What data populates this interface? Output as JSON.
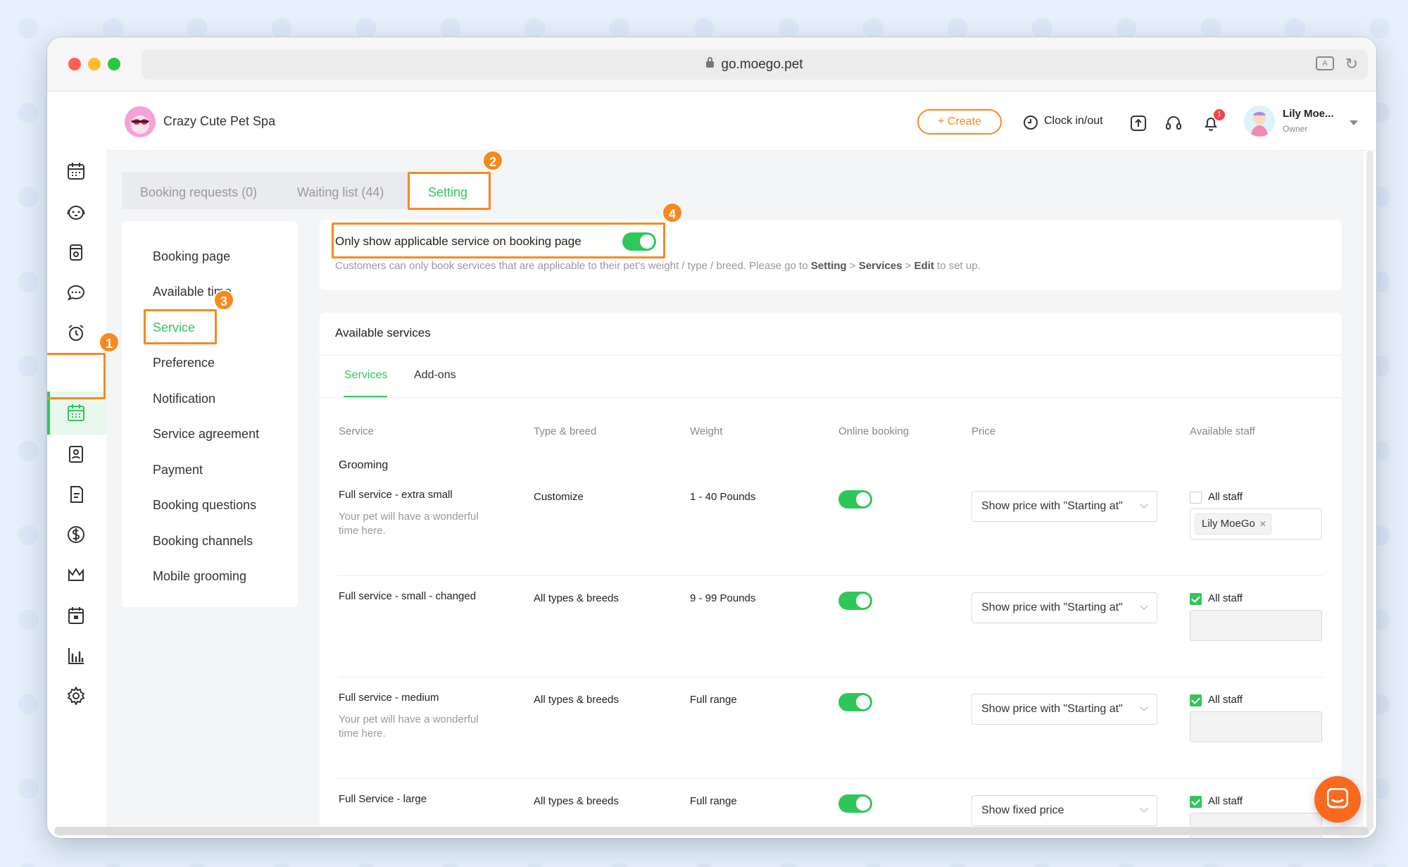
{
  "browser": {
    "url": "go.moego.pet"
  },
  "business": {
    "name": "Crazy Cute Pet Spa"
  },
  "topbar": {
    "create_label": "+ Create",
    "clock_label": "Clock in/out",
    "notif_count": "1",
    "user_name": "Lily Moe...",
    "user_role": "Owner"
  },
  "tabs": {
    "booking_requests": "Booking requests (0)",
    "waiting_list": "Waiting list (44)",
    "setting": "Setting"
  },
  "menu": [
    "Booking page",
    "Available time",
    "Service",
    "Preference",
    "Notification",
    "Service agreement",
    "Payment",
    "Booking questions",
    "Booking channels",
    "Mobile grooming"
  ],
  "applicable": {
    "label": "Only show applicable service on booking page",
    "desc_pre": "Customers can only book services that are applicable to their pet's weight / type / breed. Please go to ",
    "desc_b1": "Setting",
    "desc_sep1": " > ",
    "desc_b2": "Services",
    "desc_sep2": " > ",
    "desc_b3": "Edit",
    "desc_post": " to set up.",
    "enabled": true
  },
  "available": {
    "title": "Available services",
    "subtabs": [
      "Services",
      "Add-ons"
    ],
    "columns": [
      "Service",
      "Type & breed",
      "Weight",
      "Online booking",
      "Price",
      "Available staff"
    ],
    "group": "Grooming",
    "rows": [
      {
        "name": "Full service - extra small",
        "desc": "Your pet will have a wonderful time here.",
        "desc1": "Your pet will have a wonderful",
        "desc2": "time here.",
        "type": "Customize",
        "weight": "1 - 40 Pounds",
        "online": true,
        "price": "Show price with \"Starting at\"",
        "all_staff": false,
        "staff_label": "All staff",
        "staff_tag": "Lily MoeGo"
      },
      {
        "name": "Full service - small - changed",
        "desc1": "",
        "desc2": "",
        "type": "All types & breeds",
        "weight": "9 - 99 Pounds",
        "online": true,
        "price": "Show price with \"Starting at\"",
        "all_staff": true,
        "staff_label": "All staff",
        "staff_tag": ""
      },
      {
        "name": "Full service - medium",
        "desc1": "Your pet will have a wonderful",
        "desc2": "time here.",
        "type": "All types & breeds",
        "weight": "Full range",
        "online": true,
        "price": "Show price with \"Starting at\"",
        "all_staff": true,
        "staff_label": "All staff",
        "staff_tag": ""
      },
      {
        "name": "Full Service - large",
        "desc1": "",
        "desc2": "",
        "type": "All types & breeds",
        "weight": "Full range",
        "online": true,
        "price": "Show fixed price",
        "all_staff": true,
        "staff_label": "All staff",
        "staff_tag": ""
      }
    ]
  },
  "annotations": [
    "1",
    "2",
    "3",
    "4"
  ],
  "colors": {
    "accent": "#30c75a",
    "highlight": "#f7891f",
    "create": "#f7891f",
    "notif": "#f04545"
  }
}
